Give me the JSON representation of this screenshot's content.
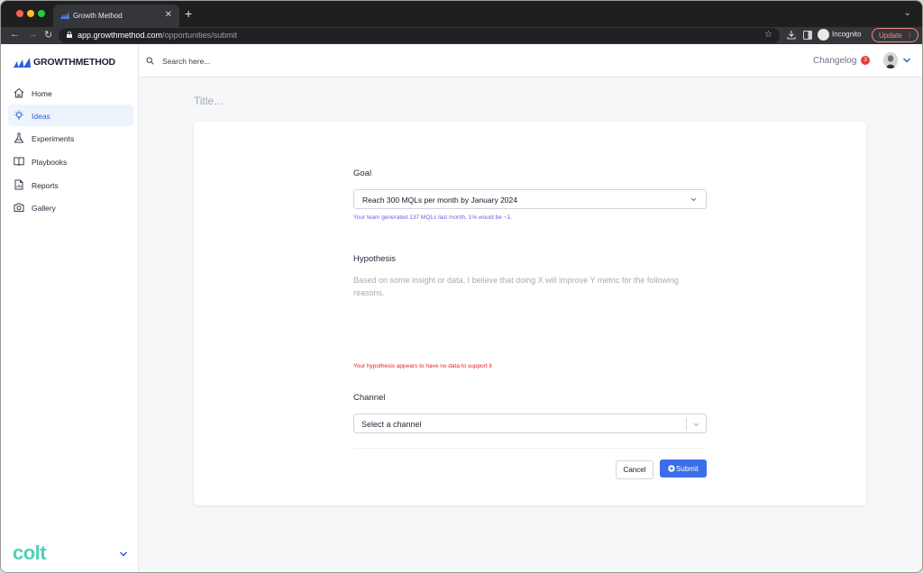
{
  "browser": {
    "tab_title": "Growth Method",
    "url_host": "app.growthmethod.com",
    "url_path": "/opportunities/submit",
    "incognito_label": "Incognito",
    "update_label": "Update"
  },
  "app": {
    "brand": "GROWTHMETHOD",
    "org_logo": "colt",
    "colors": {
      "accent": "#3b6ee8",
      "active_nav_bg": "#eef4fd",
      "error": "#e02424",
      "hint": "#6d63e8",
      "org_brand": "#4fd1b5"
    }
  },
  "sidebar": {
    "items": [
      {
        "label": "Home",
        "icon": "home-icon",
        "active": false
      },
      {
        "label": "Ideas",
        "icon": "lightbulb-icon",
        "active": true
      },
      {
        "label": "Experiments",
        "icon": "flask-icon",
        "active": false
      },
      {
        "label": "Playbooks",
        "icon": "book-icon",
        "active": false
      },
      {
        "label": "Reports",
        "icon": "report-icon",
        "active": false
      },
      {
        "label": "Gallery",
        "icon": "camera-icon",
        "active": false
      }
    ]
  },
  "header": {
    "search_placeholder": "Search here...",
    "changelog_label": "Changelog",
    "changelog_count": "3"
  },
  "form": {
    "title_placeholder": "Title...",
    "goal_label": "Goal",
    "goal_value": "Reach 300 MQLs per month by January 2024",
    "goal_hint": "Your team generated 137 MQLs last month, 1% would be ~1.",
    "hypothesis_label": "Hypothesis",
    "hypothesis_placeholder": "Based on some insight or data, I believe that doing X will improve Y metric for the following reasons.",
    "hypothesis_error": "Your hypothesis appears to have no data to support it",
    "channel_label": "Channel",
    "channel_placeholder": "Select a channel",
    "cancel_label": "Cancel",
    "submit_label": "Submit"
  }
}
